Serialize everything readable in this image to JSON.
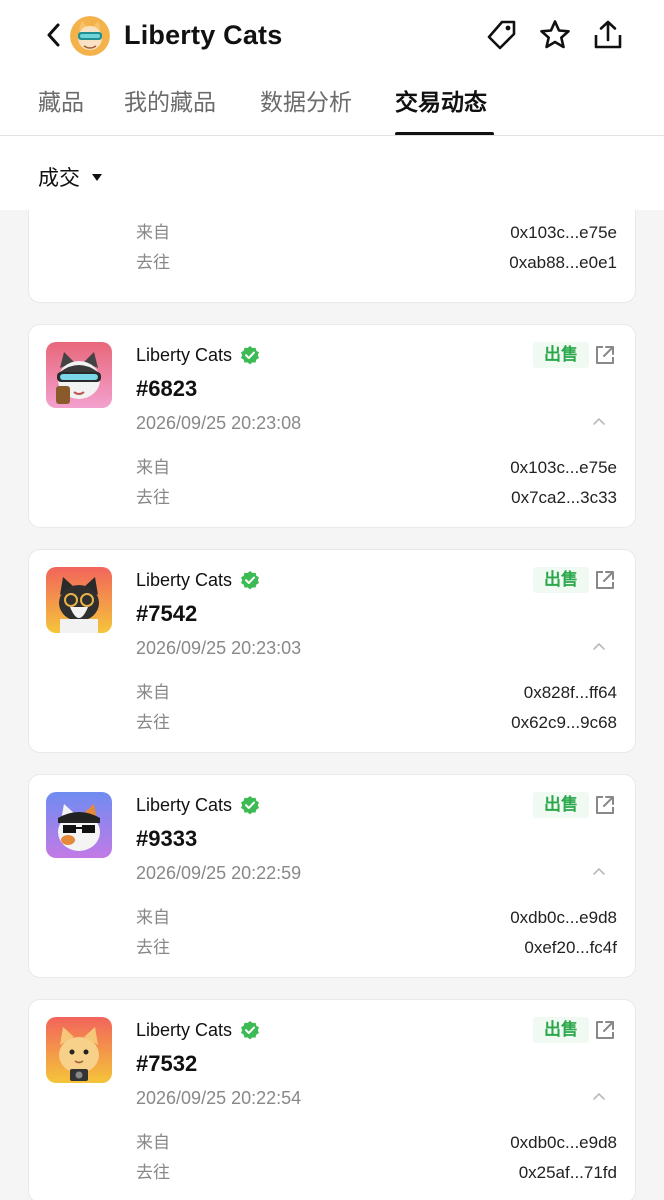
{
  "header": {
    "title": "Liberty Cats",
    "back_icon": "chevron-left-icon",
    "actions": [
      "tag-icon",
      "star-icon",
      "share-icon"
    ]
  },
  "tabs": [
    {
      "label": "藏品",
      "active": false
    },
    {
      "label": "我的藏品",
      "active": false
    },
    {
      "label": "数据分析",
      "active": false
    },
    {
      "label": "交易动态",
      "active": true
    }
  ],
  "filter": {
    "label": "成交"
  },
  "labels": {
    "from": "来自",
    "to": "去往"
  },
  "partial_card": {
    "from": "0x103c...e75e",
    "to": "0xab88...e0e1"
  },
  "activities": [
    {
      "collection": "Liberty Cats",
      "token": "#6823",
      "time": "2026/09/25 20:23:08",
      "type": "出售",
      "from": "0x103c...e75e",
      "to": "0x7ca2...3c33",
      "bg": [
        "#e8677a",
        "#f3a1cf"
      ]
    },
    {
      "collection": "Liberty Cats",
      "token": "#7542",
      "time": "2026/09/25 20:23:03",
      "type": "出售",
      "from": "0x828f...ff64",
      "to": "0x62c9...9c68",
      "bg": [
        "#f2645c",
        "#f5c53a"
      ]
    },
    {
      "collection": "Liberty Cats",
      "token": "#9333",
      "time": "2026/09/25 20:22:59",
      "type": "出售",
      "from": "0xdb0c...e9d8",
      "to": "0xef20...fc4f",
      "bg": [
        "#6f8cf1",
        "#c27ae6"
      ]
    },
    {
      "collection": "Liberty Cats",
      "token": "#7532",
      "time": "2026/09/25 20:22:54",
      "type": "出售",
      "from": "0xdb0c...e9d8",
      "to": "0x25af...71fd",
      "bg": [
        "#f2645c",
        "#f5c53a"
      ]
    }
  ],
  "colors": {
    "accent_green": "#2aa84a",
    "verified_green": "#3cba54",
    "text_muted": "#888888"
  }
}
